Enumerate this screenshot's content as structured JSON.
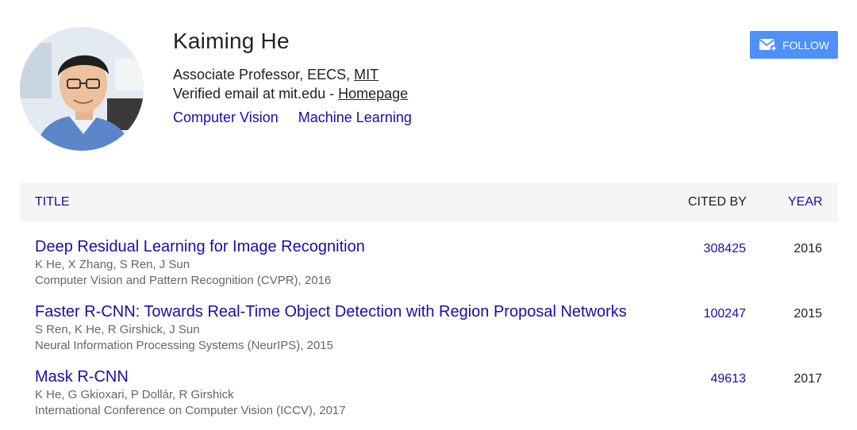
{
  "profile": {
    "name": "Kaiming He",
    "position": "Associate Professor, EECS, ",
    "affiliation_link": "MIT",
    "email_text": "Verified email at mit.edu - ",
    "homepage_link": "Homepage",
    "interests": [
      "Computer Vision",
      "Machine Learning"
    ]
  },
  "follow_button": {
    "label": "FOLLOW",
    "icon": "mail-plus-icon",
    "color": "#4d90fe"
  },
  "table": {
    "headers": {
      "title": "TITLE",
      "cited_by": "CITED BY",
      "year": "YEAR"
    },
    "rows": [
      {
        "title": "Deep Residual Learning for Image Recognition",
        "authors": "K He, X Zhang, S Ren, J Sun",
        "venue": "Computer Vision and Pattern Recognition (CVPR), 2016",
        "cited_by": "308425",
        "year": "2016"
      },
      {
        "title": "Faster R-CNN: Towards Real-Time Object Detection with Region Proposal Networks",
        "authors": "S Ren, K He, R Girshick, J Sun",
        "venue": "Neural Information Processing Systems (NeurIPS), 2015",
        "cited_by": "100247",
        "year": "2015"
      },
      {
        "title": "Mask R-CNN",
        "authors": "K He, G Gkioxari, P Dollár, R Girshick",
        "venue": "International Conference on Computer Vision (ICCV), 2017",
        "cited_by": "49613",
        "year": "2017"
      }
    ]
  },
  "colors": {
    "link": "#1a0dab",
    "header_bg": "#f5f5f5",
    "meta_text": "#666666"
  }
}
